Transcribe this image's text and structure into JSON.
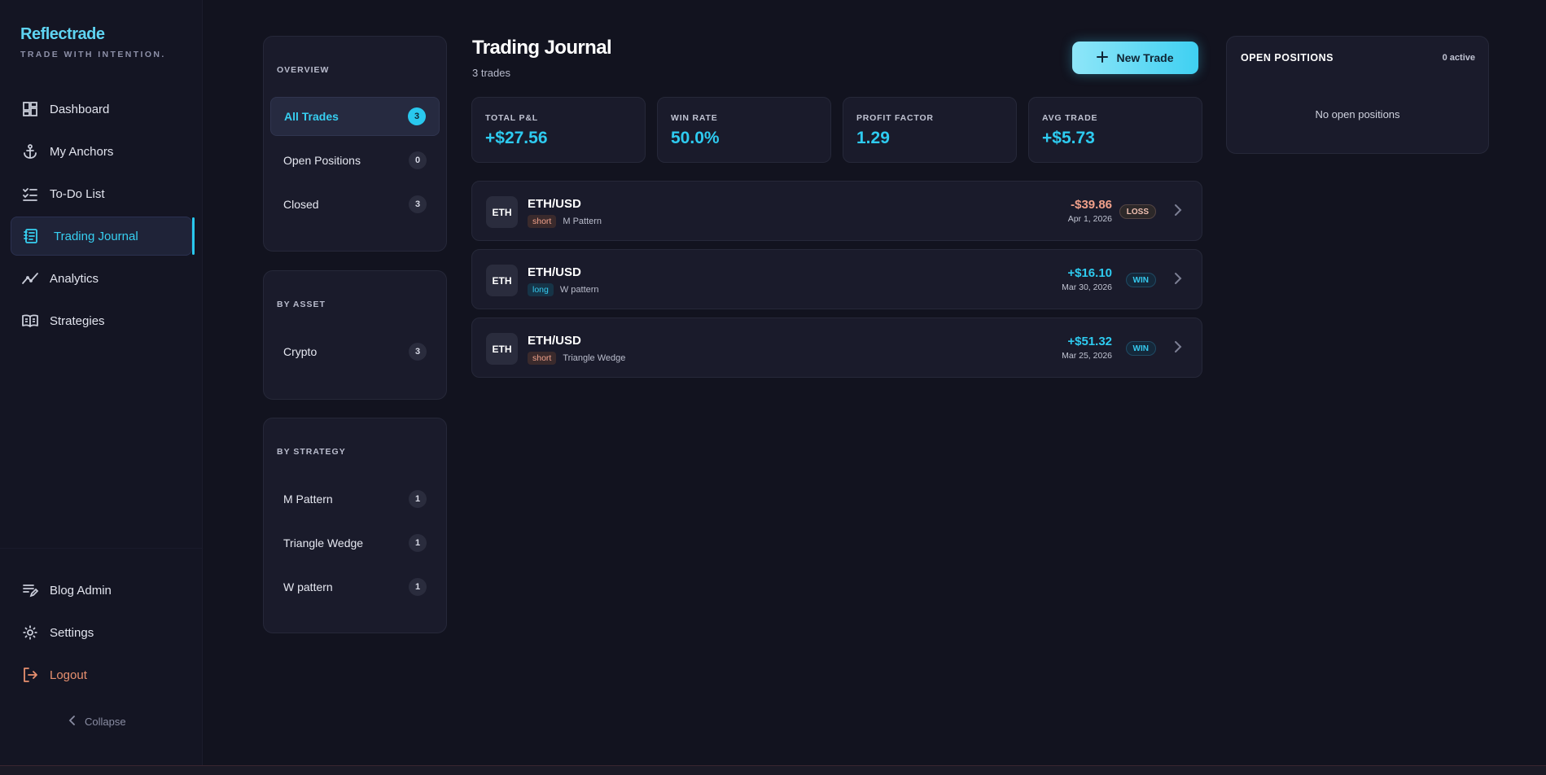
{
  "brand": {
    "name": "Reflectrade",
    "tagline": "TRADE WITH INTENTION."
  },
  "nav": {
    "items": [
      {
        "label": "Dashboard",
        "icon": "dashboard-icon"
      },
      {
        "label": "My Anchors",
        "icon": "anchor-icon"
      },
      {
        "label": "To-Do List",
        "icon": "checklist-icon"
      },
      {
        "label": "Trading Journal",
        "icon": "journal-icon",
        "active": true
      },
      {
        "label": "Analytics",
        "icon": "analytics-icon"
      },
      {
        "label": "Strategies",
        "icon": "book-icon"
      }
    ],
    "bottom": [
      {
        "label": "Blog Admin",
        "icon": "edit-list-icon"
      },
      {
        "label": "Settings",
        "icon": "gear-icon"
      },
      {
        "label": "Logout",
        "icon": "logout-icon"
      }
    ],
    "collapse_label": "Collapse"
  },
  "filters": {
    "overview": {
      "title": "OVERVIEW",
      "items": [
        {
          "label": "All Trades",
          "count": "3",
          "active": true
        },
        {
          "label": "Open Positions",
          "count": "0"
        },
        {
          "label": "Closed",
          "count": "3"
        }
      ]
    },
    "by_asset": {
      "title": "BY ASSET",
      "items": [
        {
          "label": "Crypto",
          "count": "3"
        }
      ]
    },
    "by_strategy": {
      "title": "BY STRATEGY",
      "items": [
        {
          "label": "M Pattern",
          "count": "1"
        },
        {
          "label": "Triangle Wedge",
          "count": "1"
        },
        {
          "label": "W pattern",
          "count": "1"
        }
      ]
    }
  },
  "main": {
    "title": "Trading Journal",
    "subtitle": "3 trades",
    "new_trade_label": "New Trade",
    "stats": [
      {
        "label": "TOTAL P&L",
        "value": "+$27.56"
      },
      {
        "label": "WIN RATE",
        "value": "50.0%"
      },
      {
        "label": "PROFIT FACTOR",
        "value": "1.29"
      },
      {
        "label": "AVG TRADE",
        "value": "+$5.73"
      }
    ],
    "trades": [
      {
        "asset": "ETH",
        "pair": "ETH/USD",
        "direction": "short",
        "strategy": "M Pattern",
        "pnl": "-$39.86",
        "date": "Apr 1, 2026",
        "result": "LOSS"
      },
      {
        "asset": "ETH",
        "pair": "ETH/USD",
        "direction": "long",
        "strategy": "W pattern",
        "pnl": "+$16.10",
        "date": "Mar 30, 2026",
        "result": "WIN"
      },
      {
        "asset": "ETH",
        "pair": "ETH/USD",
        "direction": "short",
        "strategy": "Triangle Wedge",
        "pnl": "+$51.32",
        "date": "Mar 25, 2026",
        "result": "WIN"
      }
    ]
  },
  "positions": {
    "title": "OPEN POSITIONS",
    "active_label": "0 active",
    "empty_label": "No open positions"
  },
  "colors": {
    "accent": "#29c8ee",
    "loss": "#f0a08a",
    "background": "#12131f",
    "panel": "#1a1b2b"
  }
}
